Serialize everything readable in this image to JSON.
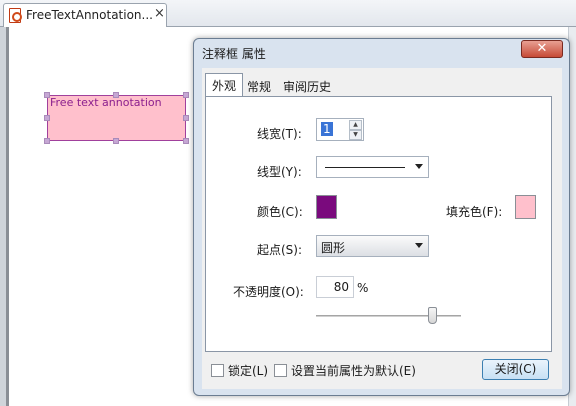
{
  "app": {
    "document_tab": {
      "title": "FreeTextAnnotation...",
      "close_symbol": "×"
    }
  },
  "annotation": {
    "text": "Free text annotation",
    "fill_color": "#ffc0cc",
    "border_color": "#a0409c",
    "text_color": "#8b1f8e"
  },
  "dialog": {
    "title": "注释框 属性",
    "close_symbol": "✕",
    "tabs": [
      {
        "label": "外观",
        "active": true
      },
      {
        "label": "常规",
        "active": false
      },
      {
        "label": "审阅历史",
        "active": false
      }
    ],
    "appearance": {
      "line_width_label": "线宽(T):",
      "line_width_value": "1",
      "line_style_label": "线型(Y):",
      "color_label": "颜色(C):",
      "color_value": "#7a0a7d",
      "fill_label": "填充色(F):",
      "fill_value": "#ffc0cc",
      "start_label": "起点(S):",
      "start_value": "圆形",
      "opacity_label": "不透明度(O):",
      "opacity_value": "80",
      "opacity_unit": "%",
      "opacity_slider_percent": 80
    },
    "footer": {
      "lock_label": "锁定(L)",
      "default_label": "设置当前属性为默认(E)",
      "close_button": "关闭(C)"
    }
  }
}
